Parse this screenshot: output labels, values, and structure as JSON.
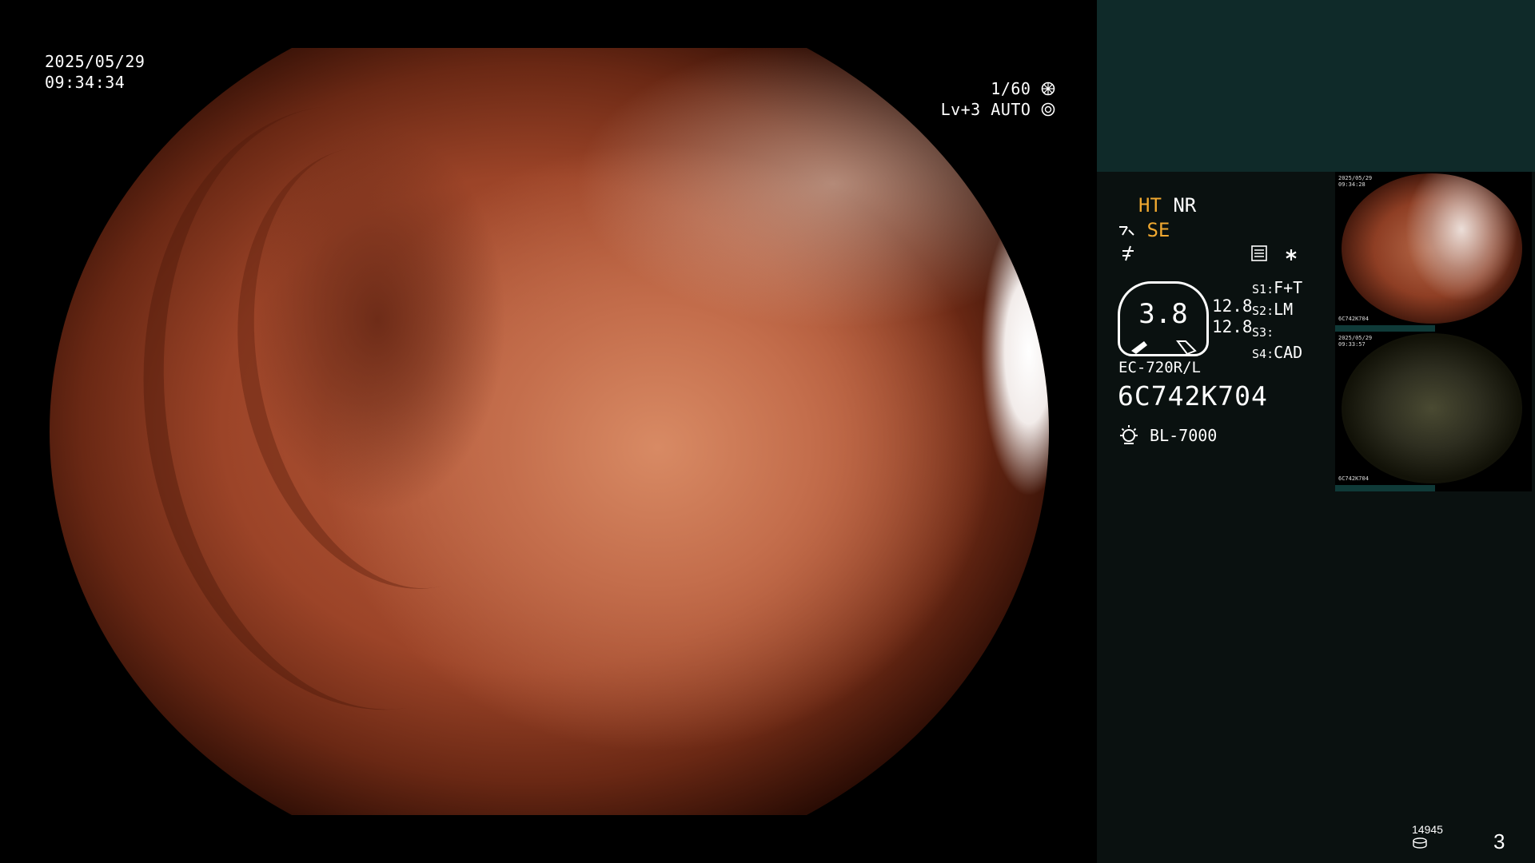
{
  "osd": {
    "date": "2025/05/29",
    "time": "09:34:34",
    "shutter": "1/60",
    "level": "Lv+3",
    "mode": "AUTO"
  },
  "panel": {
    "ht": "HT",
    "nr": "NR",
    "se": "SE",
    "zoom": "3.8",
    "val_a": "12.8",
    "val_b": "12.8",
    "switches": [
      {
        "key": "S1",
        "value": "F+T"
      },
      {
        "key": "S2",
        "value": "LM"
      },
      {
        "key": "S3",
        "value": ""
      },
      {
        "key": "S4",
        "value": "CAD"
      }
    ],
    "scope_model": "EC-720R/L",
    "serial": "6C742K704",
    "light_source": "BL-7000",
    "image_count": "14945",
    "page": "3"
  },
  "thumbnails": [
    {
      "date": "2025/05/29",
      "time": "09:34:28",
      "serial": "6C742K704"
    },
    {
      "date": "2025/05/29",
      "time": "09:33:57",
      "serial": "6C742K704"
    }
  ],
  "colors": {
    "panel_bg": "#0a1110",
    "preview_bg": "#0f2a29",
    "highlight": "#f0a830",
    "text": "#ffffff"
  },
  "icons": {
    "shutter": "aperture-icon",
    "mode": "auto-exposure-icon",
    "structure": "structure-enhancement-icon",
    "color": "color-enhancement-icon",
    "record": "record-settings-icon",
    "star": "asterisk-icon",
    "light": "light-source-icon",
    "counter": "storage-counter-icon"
  }
}
